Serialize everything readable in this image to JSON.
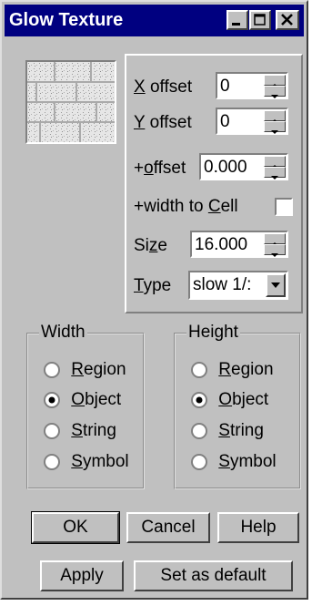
{
  "window": {
    "title": "Glow Texture"
  },
  "offsets": {
    "x_label_key": "X",
    "x_label_rest": " offset",
    "x_value": "0",
    "y_label_key": "Y",
    "y_label_rest": " offset",
    "y_value": "0",
    "plus_offset_prefix": "+",
    "plus_offset_key": "o",
    "plus_offset_rest": "ffset",
    "plus_offset_value": "0.000",
    "width_to_cell_prefix": "+width to ",
    "width_to_cell_key": "C",
    "width_to_cell_rest": "ell",
    "size_label_prefix": "Si",
    "size_label_key": "z",
    "size_label_rest": "e",
    "size_value": "16.000",
    "type_label_key": "T",
    "type_label_rest": "ype",
    "type_value": "slow 1/:"
  },
  "width_group": {
    "legend": "Width",
    "options": [
      {
        "key": "R",
        "rest": "egion",
        "selected": false
      },
      {
        "key": "O",
        "rest": "bject",
        "selected": true
      },
      {
        "key": "S",
        "rest": "tring",
        "selected": false
      },
      {
        "key": "S",
        "rest": "ymbol",
        "selected": false
      }
    ]
  },
  "height_group": {
    "legend": "Height",
    "options": [
      {
        "key": "R",
        "rest": "egion",
        "selected": false
      },
      {
        "key": "O",
        "rest": "bject",
        "selected": true
      },
      {
        "key": "S",
        "rest": "tring",
        "selected": false
      },
      {
        "key": "S",
        "rest": "ymbol",
        "selected": false
      }
    ]
  },
  "buttons": {
    "ok": "OK",
    "cancel": "Cancel",
    "help": "Help",
    "apply": "Apply",
    "set_default": "Set as default"
  }
}
